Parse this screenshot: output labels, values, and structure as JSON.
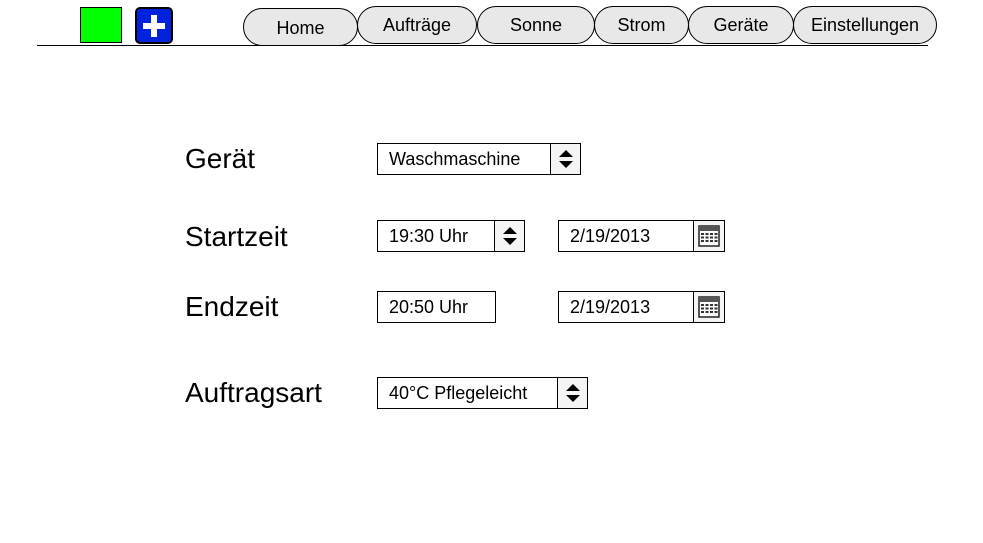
{
  "header": {
    "status_color": "#00ff00",
    "add_button_icon": "plus-icon",
    "add_button_color": "#0022dd",
    "tabs": [
      {
        "label": "Home"
      },
      {
        "label": "Aufträge"
      },
      {
        "label": "Sonne"
      },
      {
        "label": "Strom"
      },
      {
        "label": "Geräte"
      },
      {
        "label": "Einstellungen"
      }
    ]
  },
  "form": {
    "device": {
      "label": "Gerät",
      "value": "Waschmaschine",
      "control_icon": "spinner-arrows-icon"
    },
    "start": {
      "label": "Startzeit",
      "time": "19:30 Uhr",
      "date": "2/19/2013",
      "time_icon": "spinner-arrows-icon",
      "date_icon": "calendar-icon"
    },
    "end": {
      "label": "Endzeit",
      "time": "20:50 Uhr",
      "date": "2/19/2013",
      "date_icon": "calendar-icon"
    },
    "mode": {
      "label": "Auftragsart",
      "value": "40°C Pflegeleicht",
      "control_icon": "spinner-arrows-icon"
    }
  }
}
